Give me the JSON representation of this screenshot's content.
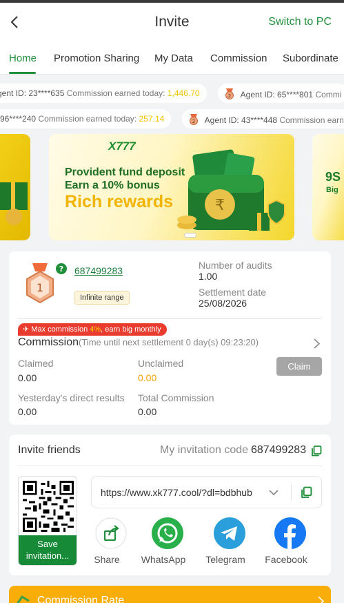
{
  "header": {
    "title": "Invite",
    "switch_label": "Switch to PC"
  },
  "tabs": [
    "Home",
    "Promotion Sharing",
    "My Data",
    "Commission",
    "Subordinate"
  ],
  "ticker": {
    "row1": [
      {
        "agent": "gent ID: 23****635",
        "label": "Commission earned today:",
        "amount": "1,446.70"
      },
      {
        "agent": "Agent ID: 65****801",
        "label": "Commi",
        "amount": ""
      }
    ],
    "row2": [
      {
        "agent": "96****240",
        "label": "Commission earned today:",
        "amount": "257.14"
      },
      {
        "agent": "Agent ID: 43****448",
        "label": "Commission earn",
        "amount": ""
      }
    ]
  },
  "banner": {
    "brand": "X777",
    "line1": "Provident fund deposit",
    "line2": "Earn a 10% bonus",
    "line3": "Rich rewards",
    "next_text": "9S",
    "next_sub": "Big"
  },
  "agent": {
    "level": "1",
    "id": "687499283",
    "range_badge": "Infinite range",
    "audits_label": "Number of audits",
    "audits_value": "1.00",
    "settlement_label": "Settlement date",
    "settlement_value": "25/08/2026"
  },
  "commission": {
    "max_prefix": "Max commission ",
    "max_pct": "4%",
    "max_suffix": ", earn big monthly",
    "title": "Commission",
    "subtitle": "(Time until next settlement  0 day(s) 09:23:20)",
    "claimed_label": "Claimed",
    "claimed_value": "0.00",
    "unclaimed_label": "Unclaimed",
    "unclaimed_value": "0.00",
    "claim_button": "Claim",
    "yesterday_label": "Yesterday's direct results",
    "yesterday_value": "0.00",
    "total_label": "Total Commission",
    "total_value": "0.00"
  },
  "invite": {
    "title": "Invite friends",
    "code_label": "My invitation code",
    "code": "687499283",
    "save_button": "Save invitation...",
    "url": "https://www.xk777.cool/?dl=bdbhub",
    "share_items": [
      "Share",
      "WhatsApp",
      "Telegram",
      "Facebook"
    ]
  },
  "bottom": {
    "label": "Commission Rate"
  },
  "colors": {
    "accent": "#1f8f3a",
    "gold": "#f5c400",
    "orange": "#f9ad08",
    "red": "#e93b2e"
  }
}
